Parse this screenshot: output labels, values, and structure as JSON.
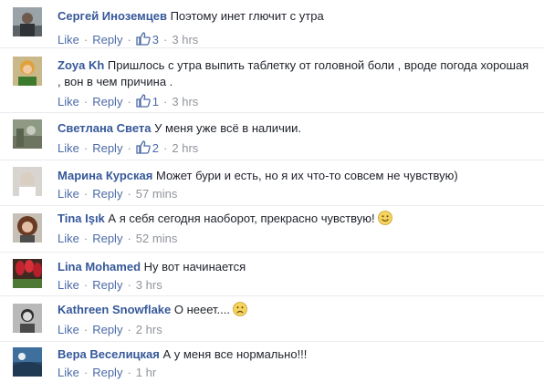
{
  "comments": [
    {
      "author": "Сергей Иноземцев",
      "text": "Поэтому инет глючит с утра",
      "like": "Like",
      "reply": "Reply",
      "like_count": "3",
      "time": "3 hrs",
      "avatar": "avatar-photo-man-dark"
    },
    {
      "author": "Zoya Kh",
      "text": "Пришлось с утра выпить таблетку от головной боли , вроде погода хорошая , вон в чем причина .",
      "like": "Like",
      "reply": "Reply",
      "like_count": "1",
      "time": "3 hrs",
      "avatar": "avatar-photo-woman-yellow"
    },
    {
      "author": "Светлана Света",
      "text": "У меня уже всё в наличии.",
      "like": "Like",
      "reply": "Reply",
      "like_count": "2",
      "time": "2 hrs",
      "avatar": "avatar-photo-landscape"
    },
    {
      "author": "Марина Курская",
      "text": "Может бури и есть, но я их что-то совсем не чувствую)",
      "like": "Like",
      "reply": "Reply",
      "like_count": "",
      "time": "57 mins",
      "avatar": "avatar-photo-woman-light"
    },
    {
      "author": "Tina Işık",
      "text": "А я себя сегодня наоборот, прекрасно чувствую!",
      "like": "Like",
      "reply": "Reply",
      "like_count": "",
      "time": "52 mins",
      "avatar": "avatar-photo-woman-curly",
      "emoji": "smile-emoji-icon"
    },
    {
      "author": "Lina Mohamed",
      "text": "Ну вот начинается",
      "like": "Like",
      "reply": "Reply",
      "like_count": "",
      "time": "3 hrs",
      "avatar": "avatar-photo-red-flowers"
    },
    {
      "author": "Kathreen Snowflake",
      "text": "О нееет....",
      "like": "Like",
      "reply": "Reply",
      "like_count": "",
      "time": "2 hrs",
      "avatar": "avatar-photo-woman-bw",
      "emoji": "frown-emoji-icon"
    },
    {
      "author": "Вера Веселицкая",
      "text": "А у меня все нормально!!!",
      "like": "Like",
      "reply": "Reply",
      "like_count": "",
      "time": "1 hr",
      "avatar": "avatar-photo-blue-scene"
    }
  ],
  "colors": {
    "author_link": "#365899",
    "action_link": "#4b6aa7",
    "meta_gray": "#90949c",
    "divider": "#e9ebee",
    "text": "#1d2129"
  }
}
